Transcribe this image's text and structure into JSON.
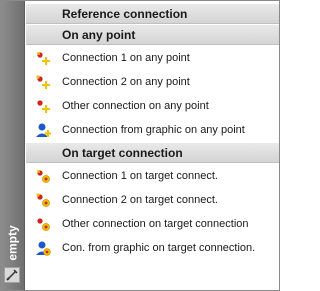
{
  "side_panel": {
    "label": "empty"
  },
  "header_reference": "Reference connection",
  "sections": [
    {
      "title": "On any point",
      "items": [
        {
          "label": "Connection 1 on any point",
          "icon": "connection-1-point-icon"
        },
        {
          "label": "Connection 2 on any point",
          "icon": "connection-2-point-icon"
        },
        {
          "label": "Other connection on any point",
          "icon": "other-connection-point-icon"
        },
        {
          "label": "Connection from graphic on any point",
          "icon": "graphic-connection-point-icon"
        }
      ]
    },
    {
      "title": "On target connection",
      "items": [
        {
          "label": "Connection 1 on target connect.",
          "icon": "connection-1-target-icon"
        },
        {
          "label": "Connection 2 on target connect.",
          "icon": "connection-2-target-icon"
        },
        {
          "label": "Other connection on target connection",
          "icon": "other-connection-target-icon"
        },
        {
          "label": "Con. from graphic on target connection.",
          "icon": "graphic-connection-target-icon"
        }
      ]
    }
  ],
  "colors": {
    "side_bar": "#7a7a7a",
    "header_bg": "#dcdcdc",
    "accent_yellow": "#f2c200",
    "accent_red": "#d42020",
    "accent_blue": "#1f56c8"
  }
}
